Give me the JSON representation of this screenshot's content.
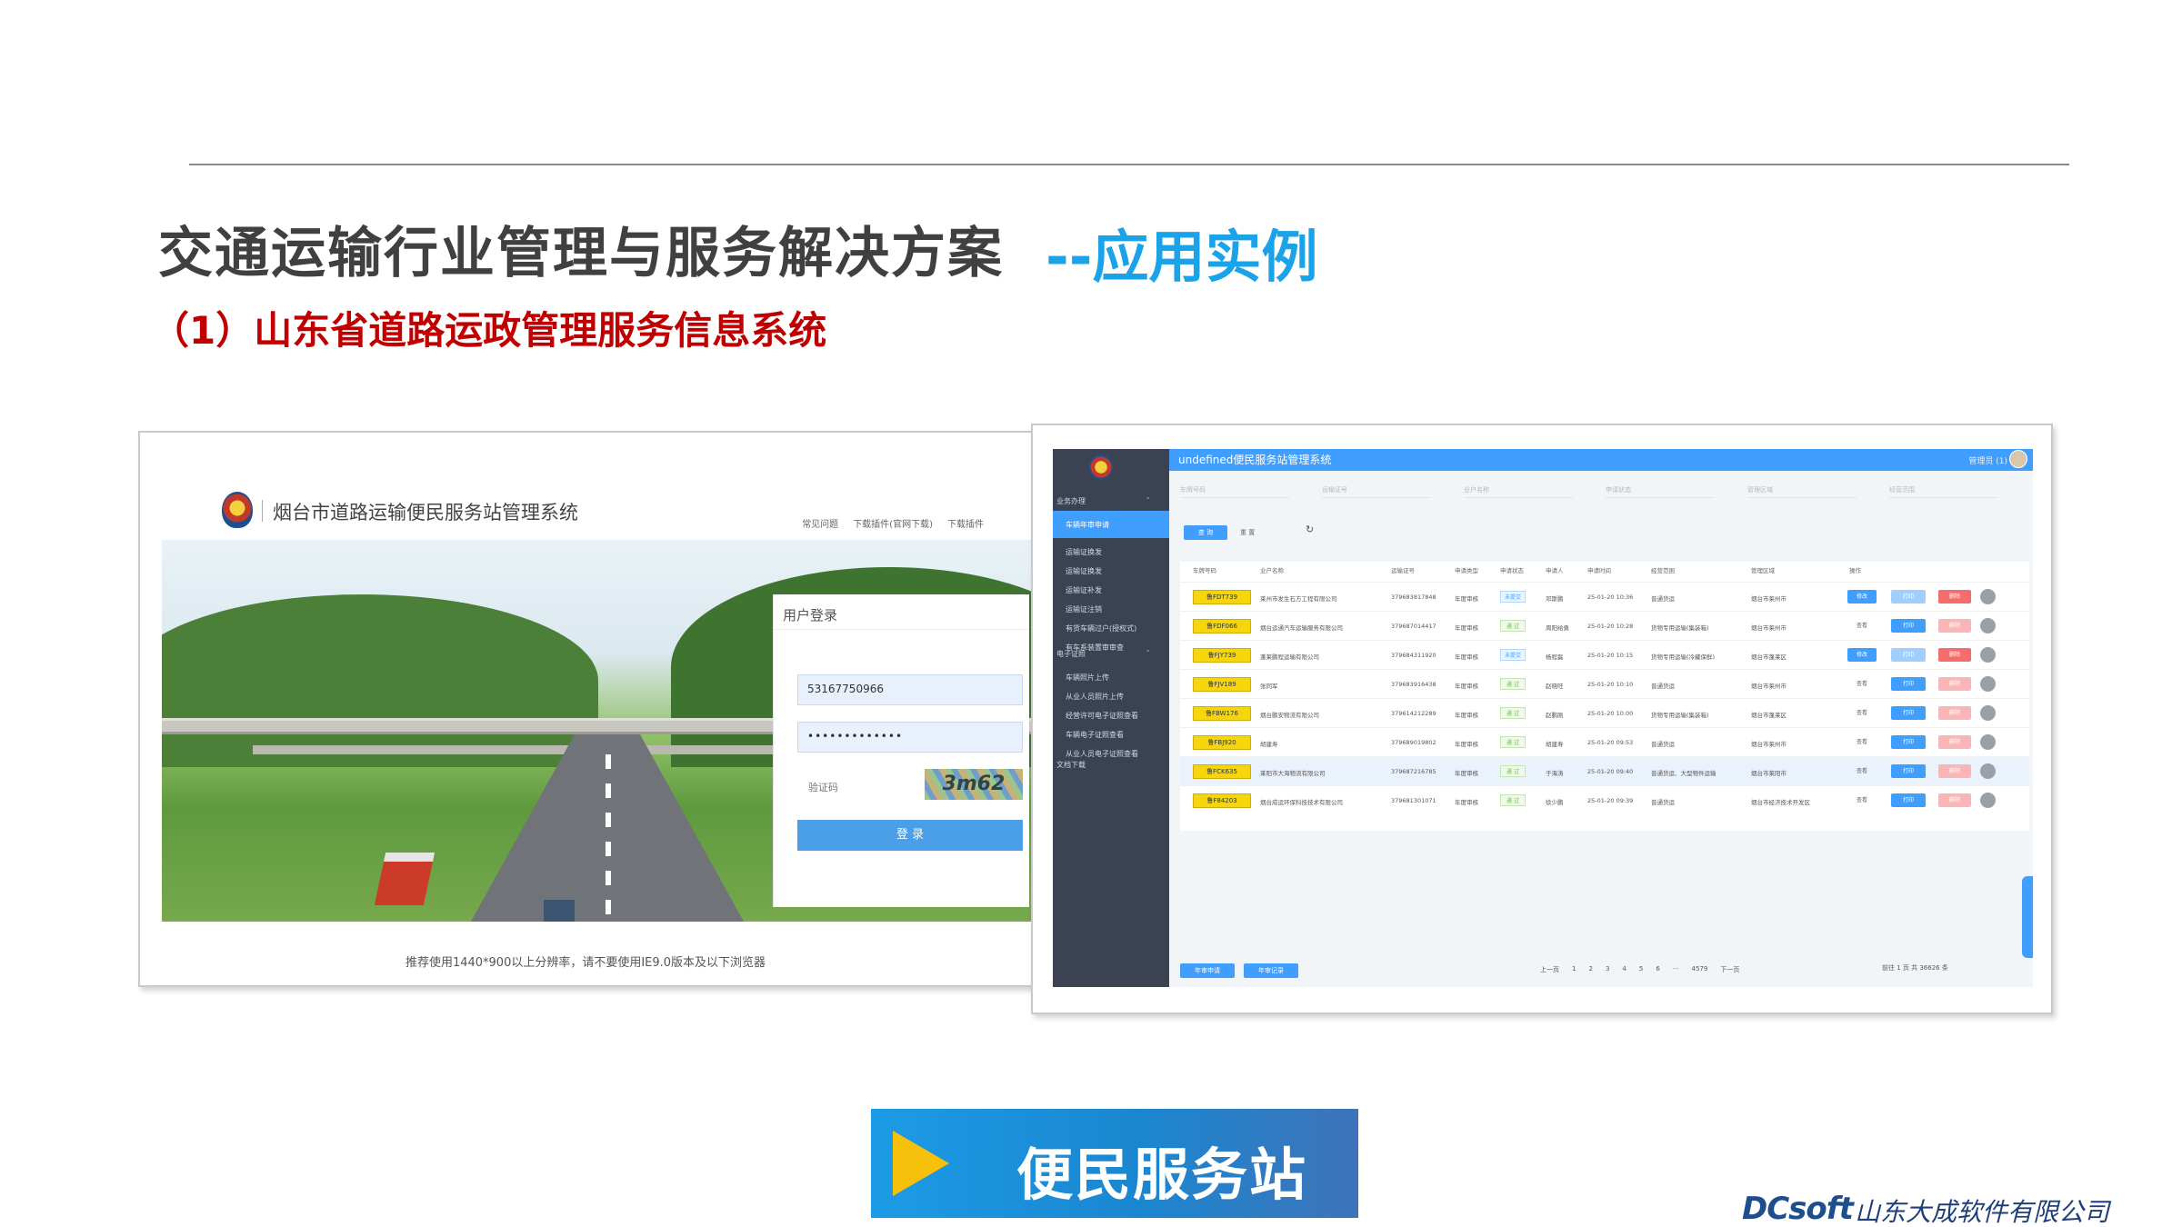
{
  "slide": {
    "title": "交通运输行业管理与服务解决方案",
    "title_accent": "--应用实例",
    "subtitle": "（1）山东省道路运政管理服务信息系统",
    "banner_text": "便民服务站",
    "company_brand": "DCsoft",
    "company_name": "山东大成软件有限公司",
    "colors": {
      "accent_blue": "#1aa3e8",
      "subtitle_red": "#c00000",
      "banner_blue": "#1b86d0",
      "play_yellow": "#f7c10b"
    }
  },
  "login": {
    "system_name": "烟台市道路运输便民服务站管理系统",
    "links": [
      "常见问题",
      "下载插件(官网下载)",
      "下载插件"
    ],
    "box_title": "用户登录",
    "username": "53167750966",
    "password": "•••••••••••••",
    "captcha_label": "验证码",
    "captcha_text": "3m62",
    "login_button": "登 录",
    "footer": "推荐使用1440*900以上分辨率，请不要使用IE9.0版本及以下浏览器"
  },
  "admin": {
    "title": "undefined便民服务站管理系统",
    "user": "管理员 (1)",
    "sidebar": {
      "groups": [
        "业务办理",
        "电子证照",
        "文档下载"
      ],
      "items_group1": [
        "车辆年审申请",
        "运输证换发",
        "运输证换发",
        "运输证补发",
        "运输证注销",
        "有货车辆过户(授权式)",
        "有车系装置审审查"
      ],
      "items_group2": [
        "车辆照片上传",
        "从业人员照片上传",
        "经营许可电子证照查看",
        "车辆电子证照查看",
        "从业人员电子证照查看"
      ]
    },
    "filters": [
      "车牌号码",
      "运输证号",
      "业户名称",
      "申请状态",
      "管理区域",
      "经营范围"
    ],
    "search_button": "查 询",
    "reset_button": "重 置",
    "columns": [
      "车牌号码",
      "业户名称",
      "运输证号",
      "申请类型",
      "申请状态",
      "申请人",
      "申请时间",
      "经营范围",
      "管理区域",
      "操作"
    ],
    "rows": [
      {
        "plate": "鲁FDT739",
        "owner": "莱州市发生石方工程有限公司",
        "cert": "379683817848",
        "type": "年度审核",
        "state": "未提交",
        "state_kind": "pending",
        "applicant": "邓斯鹏",
        "time": "25-01-20 10:36",
        "scope": "普通货运",
        "area": "烟台市莱州市",
        "op1": "修改",
        "op2": "打印",
        "op3": "删除",
        "disabled": true,
        "highlight": false
      },
      {
        "plate": "鲁FDF066",
        "owner": "烟台运通汽车运输服务有限公司",
        "cert": "379687014417",
        "type": "年度审核",
        "state": "通 过",
        "state_kind": "pass",
        "applicant": "周阳给勇",
        "time": "25-01-20 10:28",
        "scope": "货物专用运输(集装箱)",
        "area": "烟台市莱州市",
        "op1": "查看",
        "op2": "打印",
        "op3": "删除",
        "disabled": false,
        "highlight": false
      },
      {
        "plate": "鲁FJY739",
        "owner": "蓬莱鹏程运输有限公司",
        "cert": "379684311920",
        "type": "年度审核",
        "state": "未提交",
        "state_kind": "pending",
        "applicant": "杨程磊",
        "time": "25-01-20 10:15",
        "scope": "货物专用运输(冷藏保鲜)",
        "area": "烟台市蓬莱区",
        "op1": "修改",
        "op2": "打印",
        "op3": "删除",
        "disabled": true,
        "highlight": false
      },
      {
        "plate": "鲁FJV189",
        "owner": "张同军",
        "cert": "379683916438",
        "type": "年度审核",
        "state": "通 过",
        "state_kind": "pass",
        "applicant": "赵晓旺",
        "time": "25-01-20 10:10",
        "scope": "普通货运",
        "area": "烟台市莱州市",
        "op1": "查看",
        "op2": "打印",
        "op3": "删除",
        "disabled": false,
        "highlight": false
      },
      {
        "plate": "鲁FBW176",
        "owner": "烟台鹏安物流有限公司",
        "cert": "379614212289",
        "type": "年度审核",
        "state": "通 过",
        "state_kind": "pass",
        "applicant": "赵鹏刚",
        "time": "25-01-20 10:00",
        "scope": "货物专用运输(集装箱)",
        "area": "烟台市蓬莱区",
        "op1": "查看",
        "op2": "打印",
        "op3": "删除",
        "disabled": false,
        "highlight": false
      },
      {
        "plate": "鲁FBJ920",
        "owner": "胡建寿",
        "cert": "379689019802",
        "type": "年度审核",
        "state": "通 过",
        "state_kind": "pass",
        "applicant": "胡建寿",
        "time": "25-01-20 09:53",
        "scope": "普通货运",
        "area": "烟台市莱州市",
        "op1": "查看",
        "op2": "打印",
        "op3": "删除",
        "disabled": false,
        "highlight": false
      },
      {
        "plate": "鲁FCK635",
        "owner": "莱阳市大海物流有限公司",
        "cert": "379687216785",
        "type": "年度审核",
        "state": "通 过",
        "state_kind": "pass",
        "applicant": "于海涛",
        "time": "25-01-20 09:40",
        "scope": "普通货运、大型物件运输",
        "area": "烟台市莱阳市",
        "op1": "查看",
        "op2": "打印",
        "op3": "删除",
        "disabled": false,
        "highlight": true
      },
      {
        "plate": "鲁F84203",
        "owner": "烟台成运环保科技技术有限公司",
        "cert": "379681301071",
        "type": "年度审核",
        "state": "通 过",
        "state_kind": "pass",
        "applicant": "徐少鹏",
        "time": "25-01-20 09:39",
        "scope": "普通货运",
        "area": "烟台市经济技术开发区",
        "op1": "查看",
        "op2": "打印",
        "op3": "删除",
        "disabled": false,
        "highlight": false
      }
    ],
    "footer_buttons": [
      "年审申请",
      "年审记录"
    ],
    "pager": [
      "上一页",
      "1",
      "2",
      "3",
      "4",
      "5",
      "6",
      "···",
      "4579",
      "下一页"
    ],
    "goto": "前往 1 页 共 36626 条"
  }
}
